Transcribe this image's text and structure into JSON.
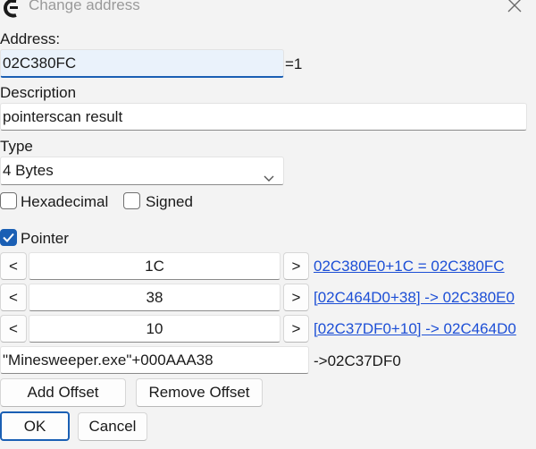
{
  "window": {
    "title": "Change address"
  },
  "address": {
    "label": "Address:",
    "value": "02C380FC",
    "suffix": "=1"
  },
  "description": {
    "label": "Description",
    "value": "pointerscan result"
  },
  "type": {
    "label": "Type",
    "selected": "4 Bytes"
  },
  "options": {
    "hex_label": "Hexadecimal",
    "hex_checked": false,
    "signed_label": "Signed",
    "signed_checked": false
  },
  "pointer": {
    "label": "Pointer",
    "checked": true,
    "offsets": [
      {
        "dec": "<",
        "value": "1C",
        "inc": ">",
        "result": "02C380E0+1C = 02C380FC"
      },
      {
        "dec": "<",
        "value": "38",
        "inc": ">",
        "result": "[02C464D0+38] -> 02C380E0"
      },
      {
        "dec": "<",
        "value": "10",
        "inc": ">",
        "result": "[02C37DF0+10] -> 02C464D0"
      }
    ],
    "base_value": "\"Minesweeper.exe\"+000AAA38",
    "base_result": "->02C37DF0"
  },
  "buttons": {
    "add_offset": "Add Offset",
    "remove_offset": "Remove Offset",
    "ok": "OK",
    "cancel": "Cancel"
  },
  "colors": {
    "accent": "#1a5fb4",
    "link": "#1d4fd6"
  }
}
